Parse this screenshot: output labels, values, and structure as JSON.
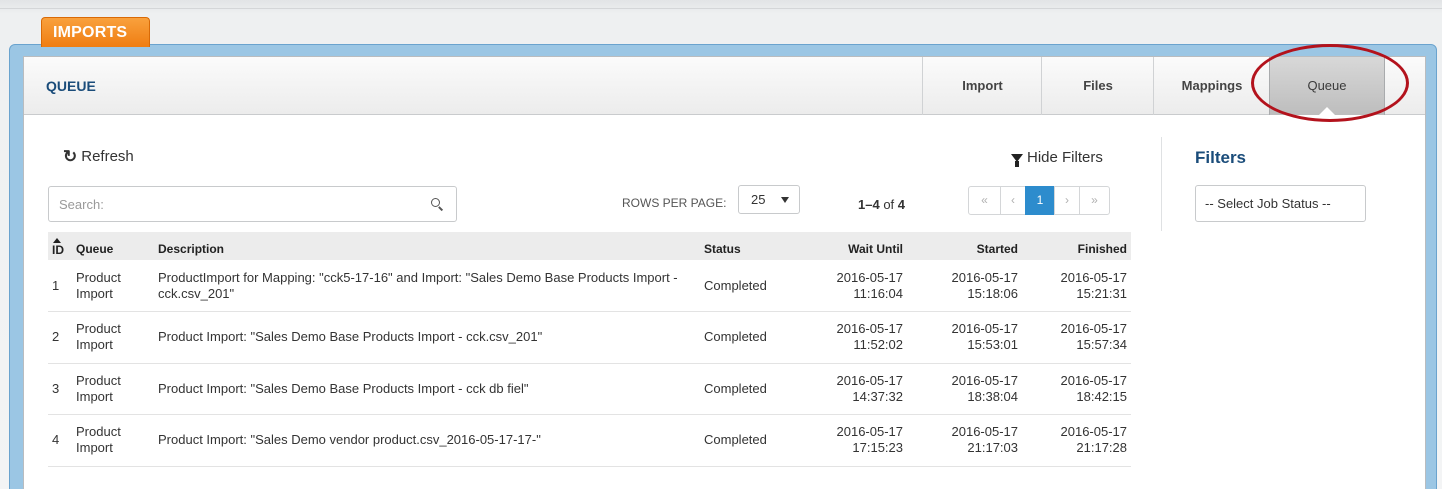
{
  "app": {
    "tab_label": "IMPORTS"
  },
  "header": {
    "title": "QUEUE",
    "nav_tabs": [
      {
        "label": "Import"
      },
      {
        "label": "Files"
      },
      {
        "label": "Mappings"
      },
      {
        "label": "Queue",
        "active": true
      }
    ]
  },
  "toolbar": {
    "refresh_label": "Refresh",
    "hide_filters_label": "Hide Filters",
    "search_placeholder": "Search:",
    "rows_per_page_label": "ROWS PER PAGE:",
    "rows_per_page_value": "25",
    "range_text": "1–4",
    "range_of": "of",
    "range_total": "4",
    "pager": {
      "first": "«",
      "prev": "‹",
      "current": "1",
      "next": "›",
      "last": "»"
    }
  },
  "table": {
    "columns": [
      "ID",
      "Queue",
      "Description",
      "Status",
      "Wait Until",
      "Started",
      "Finished"
    ],
    "rows": [
      {
        "id": "1",
        "queue": [
          "Product",
          "Import"
        ],
        "description": "ProductImport for Mapping: \"cck5-17-16\" and Import: \"Sales Demo Base Products Import - cck.csv_201\"",
        "status": "Completed",
        "wait_until": [
          "2016-05-17",
          "11:16:04"
        ],
        "started": [
          "2016-05-17",
          "15:18:06"
        ],
        "finished": [
          "2016-05-17",
          "15:21:31"
        ]
      },
      {
        "id": "2",
        "queue": [
          "Product",
          "Import"
        ],
        "description": "Product Import: \"Sales Demo Base Products Import - cck.csv_201\"",
        "status": "Completed",
        "wait_until": [
          "2016-05-17",
          "11:52:02"
        ],
        "started": [
          "2016-05-17",
          "15:53:01"
        ],
        "finished": [
          "2016-05-17",
          "15:57:34"
        ]
      },
      {
        "id": "3",
        "queue": [
          "Product",
          "Import"
        ],
        "description": "Product Import: \"Sales Demo Base Products Import - cck db fiel\"",
        "status": "Completed",
        "wait_until": [
          "2016-05-17",
          "14:37:32"
        ],
        "started": [
          "2016-05-17",
          "18:38:04"
        ],
        "finished": [
          "2016-05-17",
          "18:42:15"
        ]
      },
      {
        "id": "4",
        "queue": [
          "Product",
          "Import"
        ],
        "description": "Product Import: \"Sales Demo vendor product.csv_2016-05-17-17-\"",
        "status": "Completed",
        "wait_until": [
          "2016-05-17",
          "17:15:23"
        ],
        "started": [
          "2016-05-17",
          "21:17:03"
        ],
        "finished": [
          "2016-05-17",
          "21:17:28"
        ]
      }
    ]
  },
  "filters": {
    "title": "Filters",
    "job_status_select": "-- Select Job Status --"
  },
  "colors": {
    "accent_orange": "#f28c1e",
    "frame_blue": "#9bc6e4",
    "page_blue": "#2d8ccd",
    "highlight_red": "#b3121c"
  }
}
